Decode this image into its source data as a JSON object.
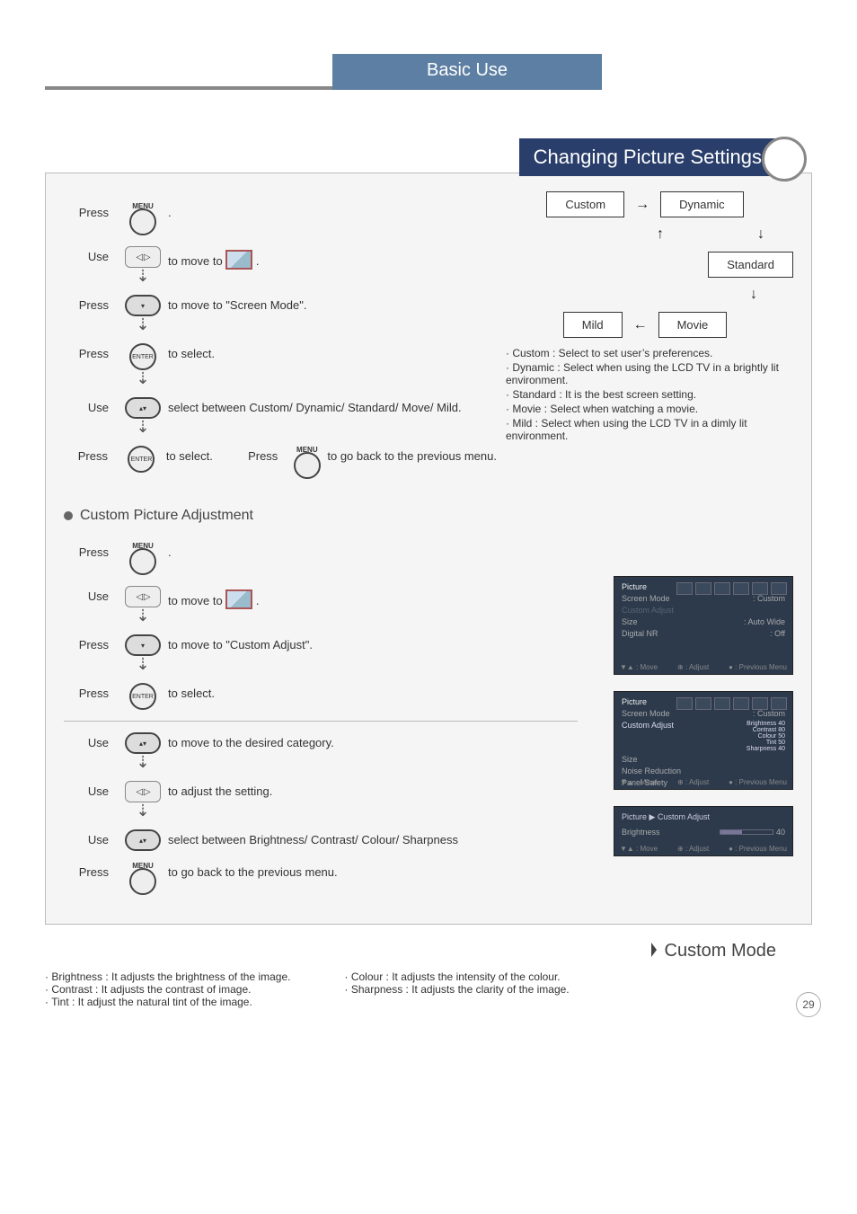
{
  "header": {
    "basic_use": "Basic Use",
    "title": "Changing Picture Settings"
  },
  "verbs": {
    "press": "Press",
    "use": "Use"
  },
  "btn": {
    "menu": "MENU",
    "enter": "ENTER",
    "lr": "◀ ▶ ▶",
    "ud": "▲/▼"
  },
  "steps1": {
    "s1": ".",
    "s2_pre": "to move to ",
    "s2_post": " .",
    "s3": "to move to \"Screen Mode\".",
    "s4": "to select.",
    "s5": "select between Custom/ Dynamic/ Standard/ Move/ Mild.",
    "s6": "to select.",
    "s6b_pre": "Press",
    "s6b_post": "to go back to the previous menu."
  },
  "modes": {
    "custom": "Custom",
    "dynamic": "Dynamic",
    "standard": "Standard",
    "mild": "Mild",
    "movie": "Movie",
    "d_custom": "· Custom : Select to set user’s preferences.",
    "d_dynamic": "· Dynamic : Select when using the LCD TV  in a brightly lit environment.",
    "d_standard": "· Standard : It is the best screen setting.",
    "d_movie": "· Movie : Select when watching a movie.",
    "d_mild": "· Mild : Select when using the LCD TV in a dimly lit environment."
  },
  "subhead": "Custom Picture Adjustment",
  "steps2": {
    "s1": ".",
    "s2_pre": "to move to ",
    "s2_post": " .",
    "s3": "to move to \"Custom Adjust\".",
    "s4": "to select.",
    "s5": "to  move to the desired category.",
    "s6": "to adjust the setting.",
    "s7": "select between Brightness/ Contrast/ Colour/ Sharpness",
    "s8": "to go back to the previous menu."
  },
  "tv1": {
    "sidebar": "Picture",
    "r1a": "Screen Mode",
    "r1b": ": Custom",
    "r2a": "Custom Adjust",
    "r3a": "Size",
    "r3b": ": Auto Wide",
    "r4a": "Digital NR",
    "r4b": ": Off",
    "f1": "▼▲ : Move",
    "f2": "⊕ : Adjust",
    "f3": "● : Previous Menu"
  },
  "tv2": {
    "sidebar": "Picture",
    "r1a": "Screen Mode",
    "r1b": ": Custom",
    "r2a": "Custom Adjust",
    "r2b_a": "Brightness",
    "r2b_av": "40",
    "r2c_a": "Contrast",
    "r2c_av": "80",
    "r2d_a": "Colour",
    "r2d_av": "50",
    "r2e_a": "Tint",
    "r2e_av": "50",
    "r2f_a": "Sharpness",
    "r2f_av": "40",
    "r3a": "Size",
    "r4a": "Noise Reduction",
    "r6a": "Panel Safety",
    "f1": "▼▲ : Move",
    "f2": "⊕ : Adjust",
    "f3": "● : Previous Menu"
  },
  "tv3": {
    "title": "Picture ▶ Custom Adjust",
    "label": "Brightness",
    "val": "40",
    "f1": "▼▲ : Move",
    "f2": "⊕ : Adjust",
    "f3": "● : Previous Menu"
  },
  "custom_mode_head": "Custom Mode",
  "defs": {
    "l1": "Brightness : It adjusts the brightness of the image.",
    "l2": "Contrast : It adjusts the contrast of image.",
    "l3": "Tint : It adjust the natural tint of the image.",
    "r1": "Colour : It adjusts the intensity of the colour.",
    "r2": "Sharpness : It adjusts the clarity of the image."
  },
  "page_num": "29"
}
